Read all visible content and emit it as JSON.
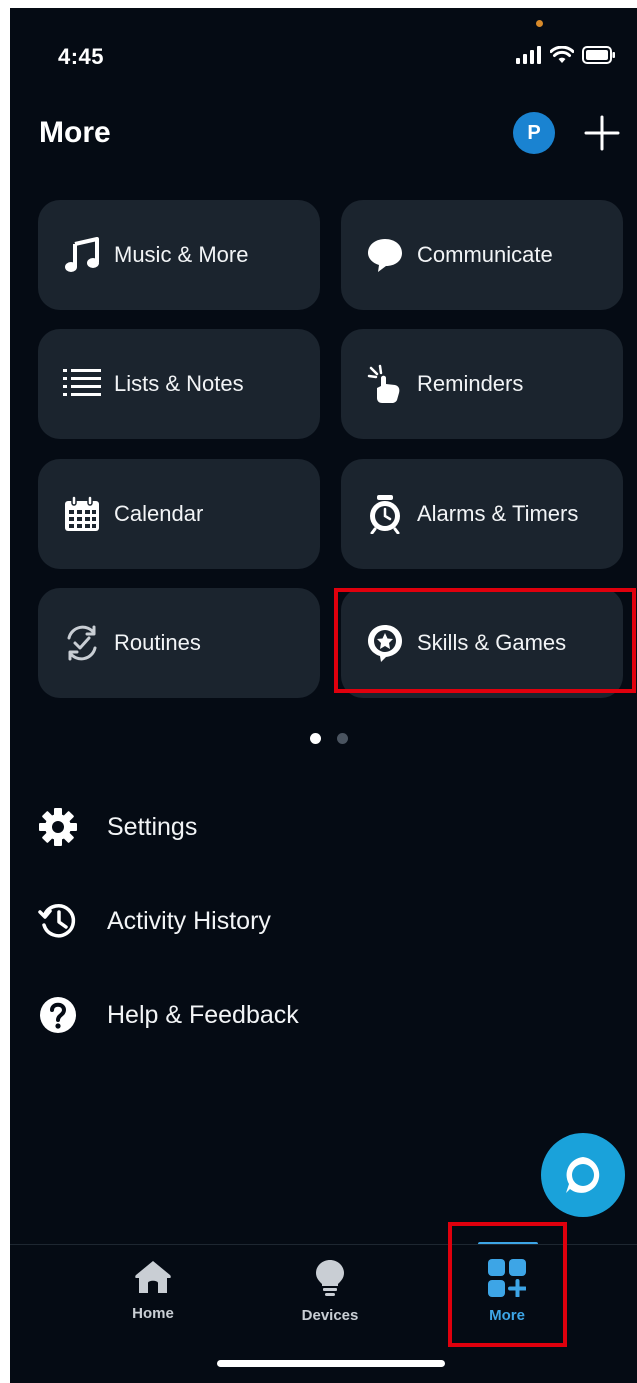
{
  "status_bar": {
    "time": "4:45"
  },
  "header": {
    "title": "More",
    "avatar_initial": "P"
  },
  "tiles": [
    {
      "label": "Music & More",
      "icon": "music-note-icon"
    },
    {
      "label": "Communicate",
      "icon": "chat-bubble-icon"
    },
    {
      "label": "Lists & Notes",
      "icon": "list-icon"
    },
    {
      "label": "Reminders",
      "icon": "reminder-hand-icon"
    },
    {
      "label": "Calendar",
      "icon": "calendar-icon"
    },
    {
      "label": "Alarms & Timers",
      "icon": "alarm-clock-icon"
    },
    {
      "label": "Routines",
      "icon": "routines-icon"
    },
    {
      "label": "Skills & Games",
      "icon": "skills-star-bubble-icon"
    }
  ],
  "pager": {
    "total": 2,
    "active": 1
  },
  "list": [
    {
      "label": "Settings",
      "icon": "gear-icon"
    },
    {
      "label": "Activity History",
      "icon": "history-clock-icon"
    },
    {
      "label": "Help & Feedback",
      "icon": "question-icon"
    }
  ],
  "nav": [
    {
      "label": "Home",
      "icon": "home-icon"
    },
    {
      "label": "Devices",
      "icon": "lightbulb-icon"
    },
    {
      "label": "More",
      "icon": "more-grid-plus-icon",
      "active": true
    }
  ],
  "colors": {
    "background": "#050b14",
    "tile": "#1b242e",
    "accent": "#3da5e6",
    "alexa": "#1aa2da",
    "highlight": "#e0000d"
  }
}
